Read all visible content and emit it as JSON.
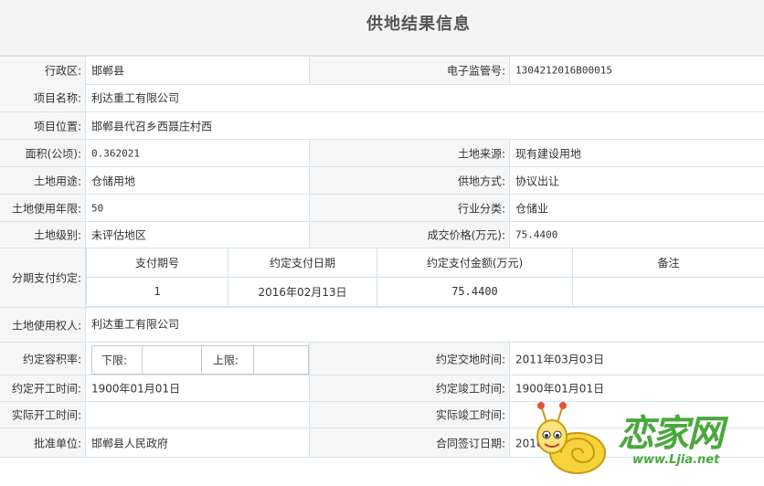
{
  "title": "供地结果信息",
  "fields": {
    "district": {
      "label": "行政区:",
      "value": "邯郸县"
    },
    "e_code": {
      "label": "电子监管号:",
      "value": "1304212016B00015"
    },
    "project_name": {
      "label": "项目名称:",
      "value": "利达重工有限公司"
    },
    "project_location": {
      "label": "项目位置:",
      "value": "邯郸县代召乡西聂庄村西"
    },
    "area": {
      "label": "面积(公顷):",
      "value": "0.362021"
    },
    "land_source": {
      "label": "土地来源:",
      "value": "现有建设用地"
    },
    "land_use": {
      "label": "土地用途:",
      "value": "仓储用地"
    },
    "supply_method": {
      "label": "供地方式:",
      "value": "协议出让"
    },
    "use_years": {
      "label": "土地使用年限:",
      "value": "50"
    },
    "industry": {
      "label": "行业分类:",
      "value": "仓储业"
    },
    "land_grade": {
      "label": "土地级别:",
      "value": "未评估地区"
    },
    "price": {
      "label": "成交价格(万元):",
      "value": "75.4400"
    },
    "installment": {
      "label": "分期支付约定:",
      "headers": [
        "支付期号",
        "约定支付日期",
        "约定支付金额(万元)",
        "备注"
      ],
      "rows": [
        [
          "1",
          "2016年02月13日",
          "75.4400",
          ""
        ]
      ]
    },
    "right_holder": {
      "label": "土地使用权人:",
      "value": "利达重工有限公司"
    },
    "far": {
      "label": "约定容积率:",
      "lower_label": "下限:",
      "lower_value": "",
      "upper_label": "上限:",
      "upper_value": ""
    },
    "handover_time": {
      "label": "约定交地时间:",
      "value": "2011年03月03日"
    },
    "start_time": {
      "label": "约定开工时间:",
      "value": "1900年01月01日"
    },
    "finish_time": {
      "label": "约定竣工时间:",
      "value": "1900年01月01日"
    },
    "actual_start": {
      "label": "实际开工时间:",
      "value": ""
    },
    "actual_finish": {
      "label": "实际竣工时间:",
      "value": ""
    },
    "approver": {
      "label": "批准单位:",
      "value": "邯郸县人民政府"
    },
    "contract_date": {
      "label": "合同签订日期:",
      "value": "2016年01月1日"
    }
  },
  "watermark": {
    "brand": "恋家网",
    "url": "www.Ljia.net"
  },
  "colors": {
    "border": "#d3e4ef",
    "label_bg": "#f6f6f6",
    "brand": "#4aa83c"
  }
}
